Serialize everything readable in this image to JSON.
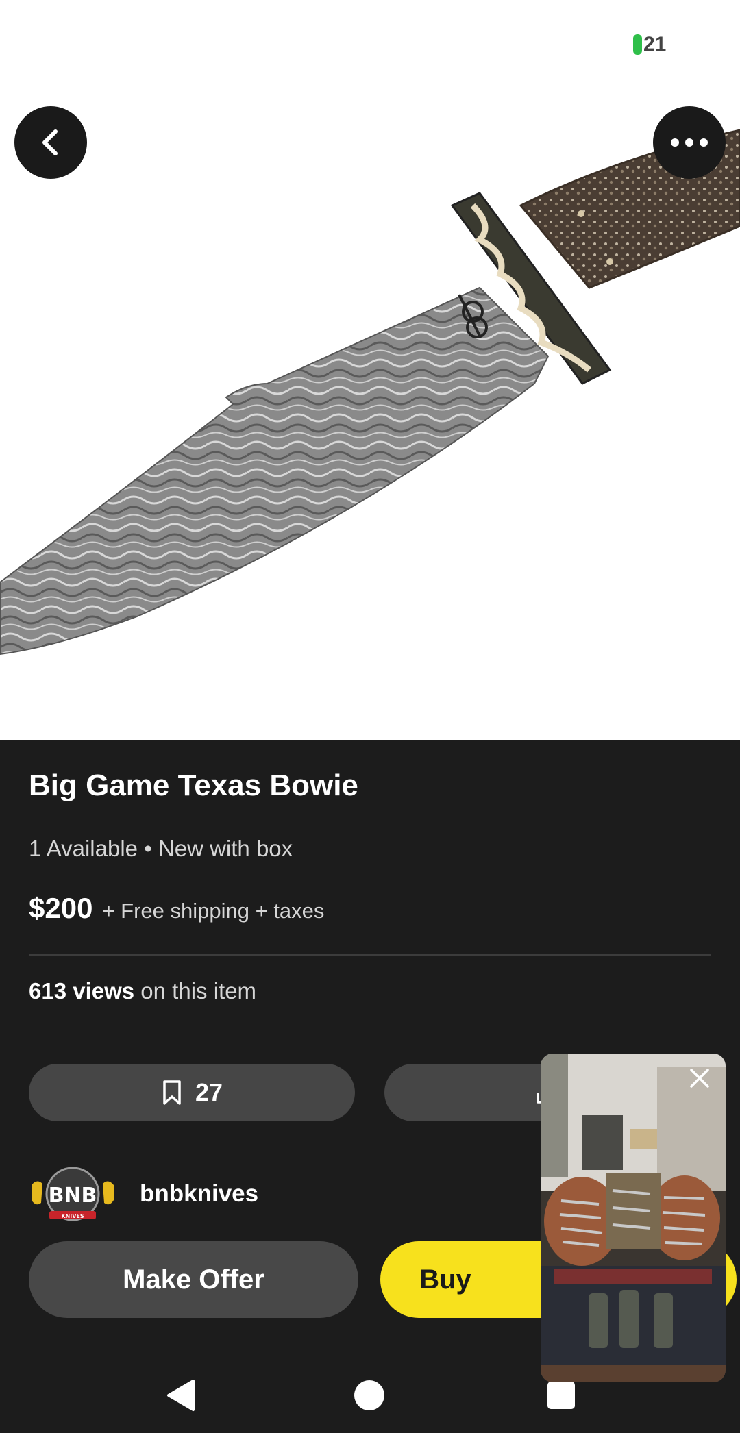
{
  "status": {
    "battery": "21"
  },
  "listing": {
    "title": "Big Game Texas Bowie",
    "availability": "1 Available • New with box",
    "price": "$200",
    "shipping": "+ Free shipping + taxes",
    "views_count": "613 views",
    "views_suffix": " on this item",
    "save_count": "27"
  },
  "seller": {
    "name": "bnbknives",
    "logo_text": "BNB",
    "logo_subtext": "KNIVES"
  },
  "actions": {
    "make_offer": "Make Offer",
    "buy": "Buy"
  },
  "colors": {
    "accent_yellow": "#f7e11d",
    "background": "#1c1c1c",
    "pill": "#464646",
    "battery_green": "#2fbf4a"
  },
  "icons": {
    "back": "chevron-left-icon",
    "more": "more-horizontal-icon",
    "save": "bookmark-icon",
    "share": "share-icon",
    "close": "close-icon"
  }
}
